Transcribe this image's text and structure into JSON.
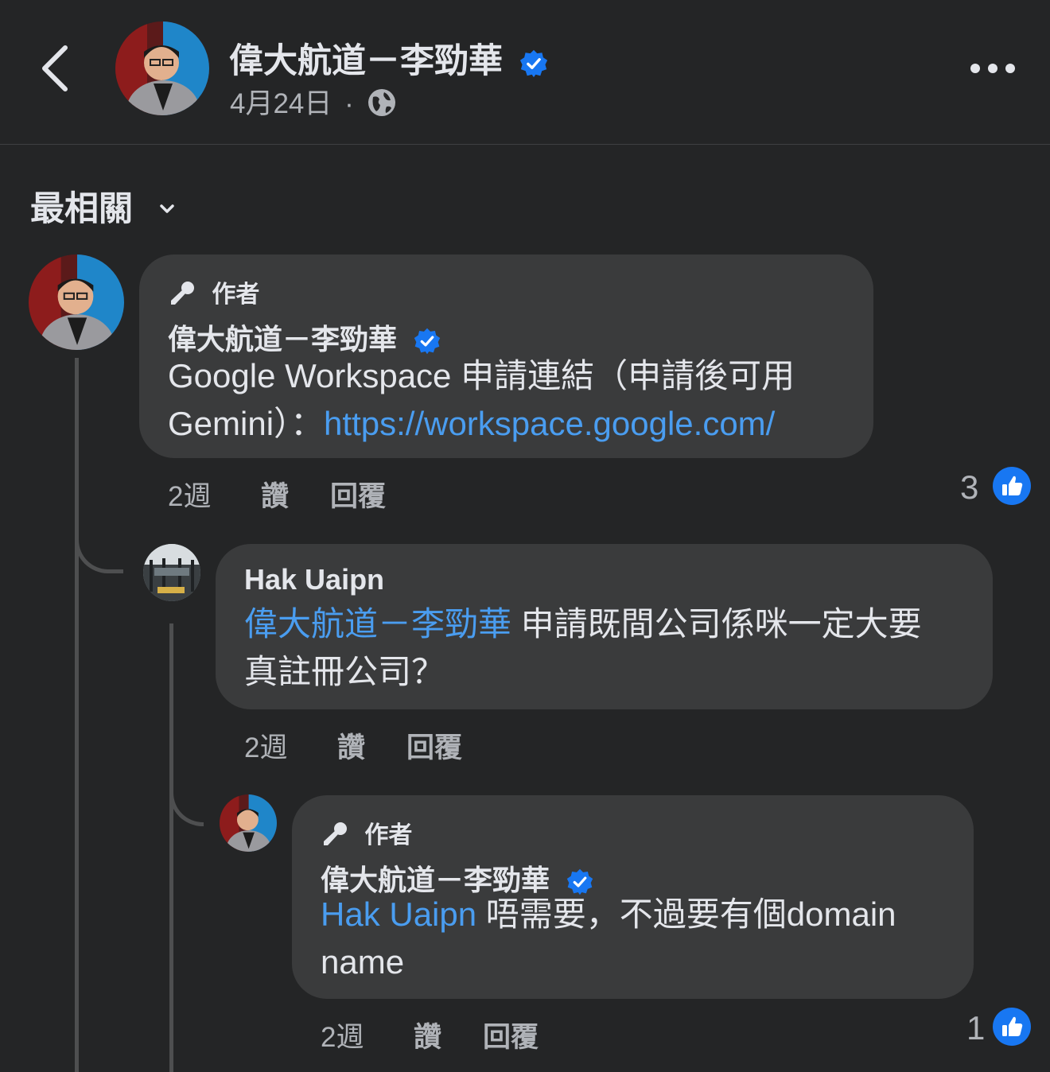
{
  "header": {
    "back_icon": "chevron-left-icon",
    "page_name": "偉大航道－李勁華",
    "verified_icon": "verified-badge-icon",
    "date": "4月24日",
    "separator": "·",
    "privacy_icon": "globe-icon",
    "more_icon": "more-horizontal-icon"
  },
  "sort": {
    "label": "最相關",
    "icon": "chevron-down-icon"
  },
  "comments": [
    {
      "badge": "作者",
      "badge_icon": "microphone-icon",
      "author": "偉大航道－李勁華",
      "text_line1": "Google Workspace 申請連結（申請後可用",
      "text_line2_prefix": " Gemini）：",
      "link": "https://workspace.google.com/",
      "time": "2週",
      "like_label": "讚",
      "reply_label": "回覆",
      "reaction_count": "3"
    },
    {
      "author": "Hak Uaipn",
      "mention": "偉大航道－李勁華",
      "text_line1": " 申請既間公司係咪一定大要",
      "text_line2": "真註冊公司？",
      "time": "2週",
      "like_label": "讚",
      "reply_label": "回覆"
    },
    {
      "badge": "作者",
      "badge_icon": "microphone-icon",
      "author": "偉大航道－李勁華",
      "mention": "Hak Uaipn",
      "text_line1": " 唔需要，不過要有個domain",
      "text_line2": "name",
      "time": "2週",
      "like_label": "讚",
      "reply_label": "回覆",
      "reaction_count": "1"
    }
  ],
  "colors": {
    "background": "#242526",
    "bubble": "#3a3b3c",
    "link": "#4a9df0",
    "like_blue": "#1877f2",
    "secondary_text": "#b0b3b8"
  }
}
